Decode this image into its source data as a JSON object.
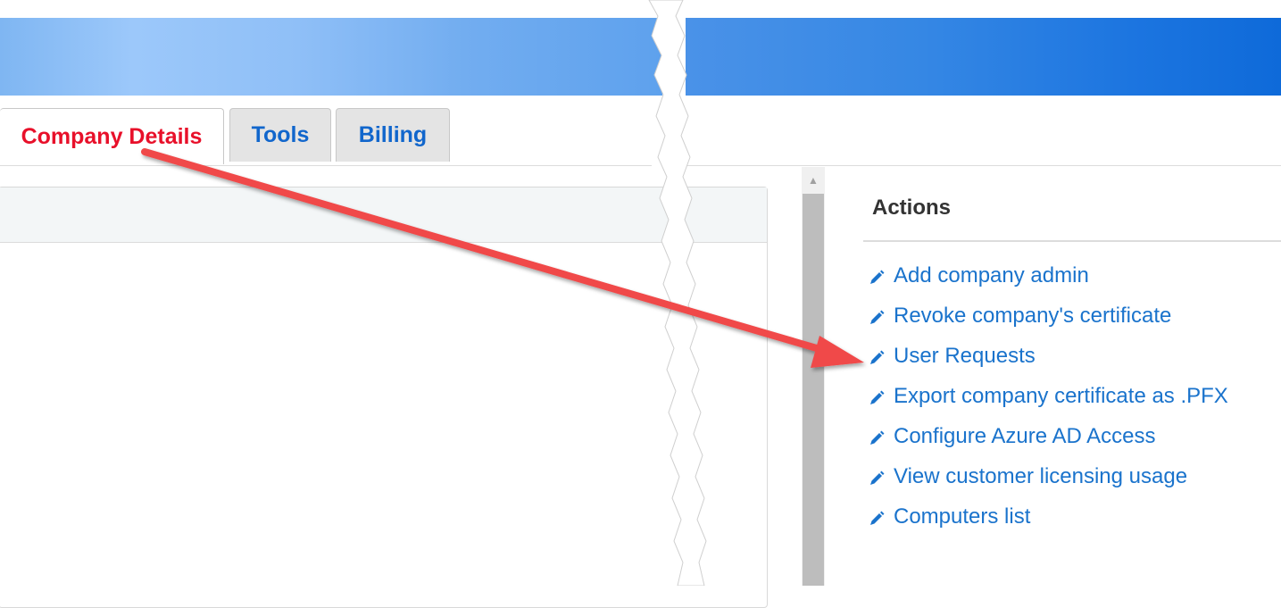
{
  "tabs": {
    "company_details": "Company Details",
    "tools": "Tools",
    "billing": "Billing"
  },
  "actions": {
    "title": "Actions",
    "items": [
      "Add company admin",
      "Revoke company's certificate",
      "User Requests",
      "Export company certificate as .PFX",
      "Configure Azure AD Access",
      "View customer licensing usage",
      "Computers list"
    ]
  },
  "colors": {
    "active_tab_text": "#e8102a",
    "tab_text": "#1166cc",
    "link": "#1a73cc",
    "annotation_arrow": "#f04848"
  },
  "icons": {
    "action_icon": "pencil-icon",
    "scroll_up": "triangle-up-icon"
  }
}
